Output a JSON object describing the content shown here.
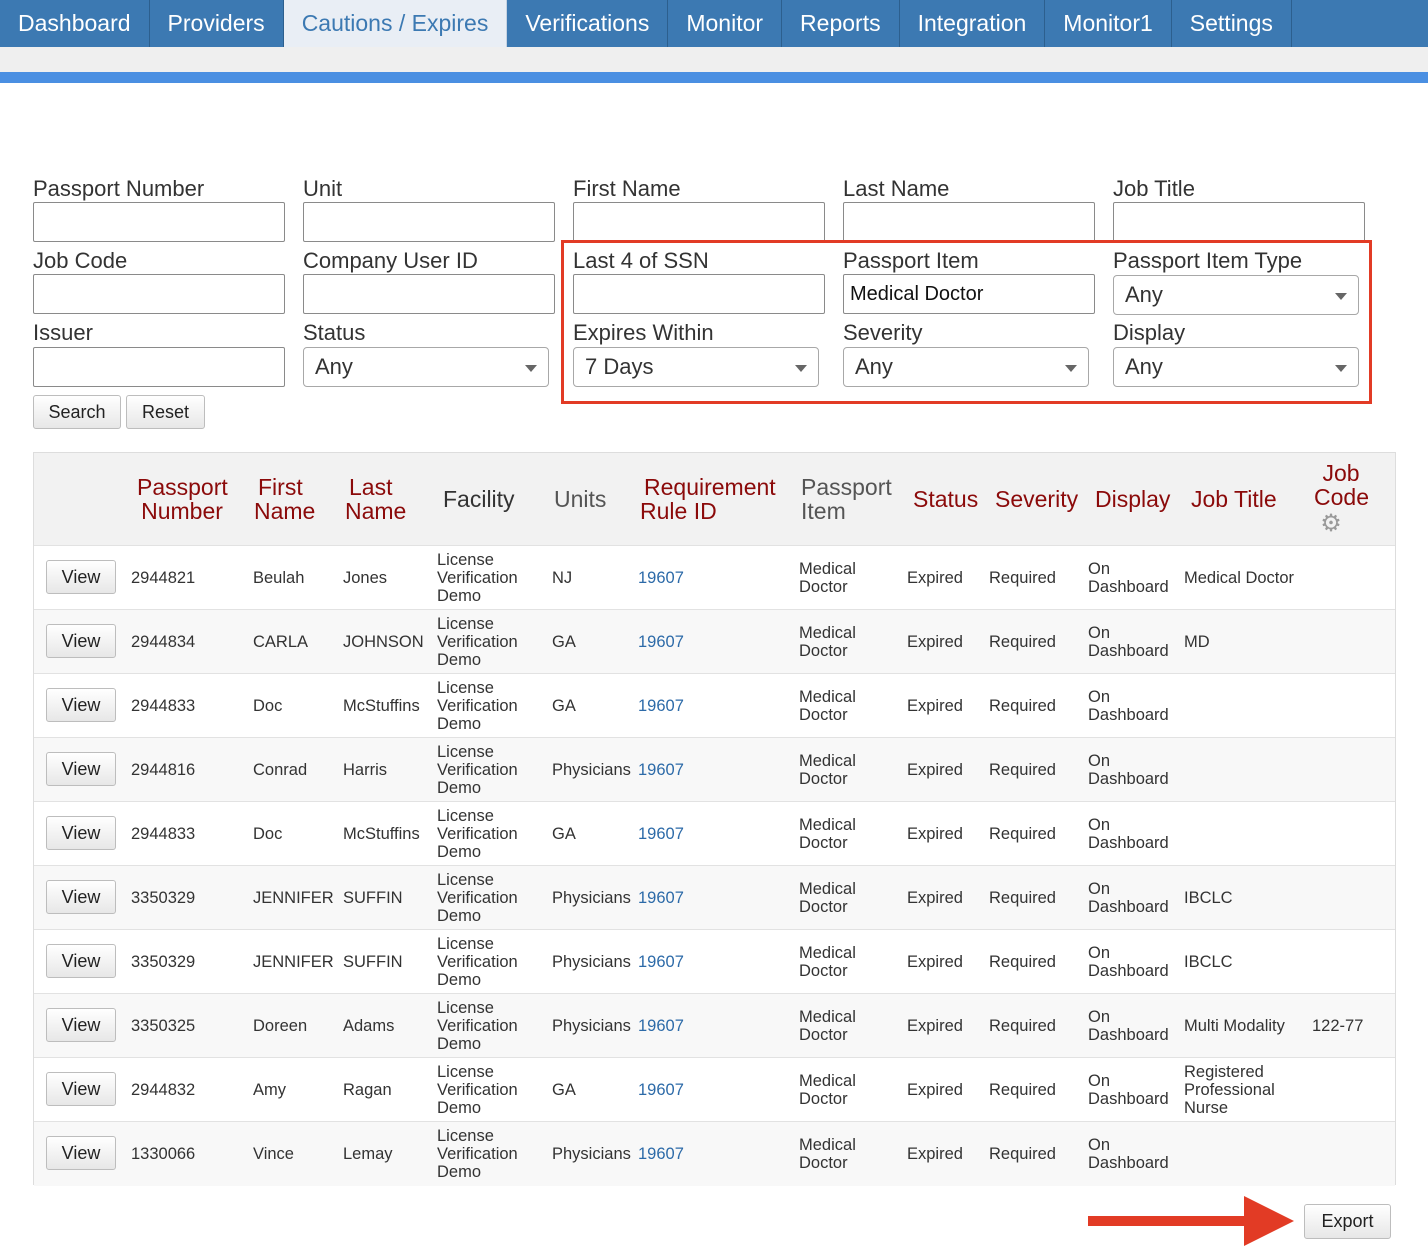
{
  "nav": {
    "tabs": [
      {
        "label": "Dashboard",
        "active": false
      },
      {
        "label": "Providers",
        "active": false
      },
      {
        "label": "Cautions / Expires",
        "active": true
      },
      {
        "label": "Verifications",
        "active": false
      },
      {
        "label": "Monitor",
        "active": false
      },
      {
        "label": "Reports",
        "active": false
      },
      {
        "label": "Integration",
        "active": false
      },
      {
        "label": "Monitor1",
        "active": false
      },
      {
        "label": "Settings",
        "active": false
      }
    ]
  },
  "filters": {
    "passport_number": {
      "label": "Passport Number",
      "value": ""
    },
    "unit": {
      "label": "Unit",
      "value": ""
    },
    "first_name": {
      "label": "First Name",
      "value": ""
    },
    "last_name": {
      "label": "Last Name",
      "value": ""
    },
    "job_title": {
      "label": "Job Title",
      "value": ""
    },
    "job_code": {
      "label": "Job Code",
      "value": ""
    },
    "company_user_id": {
      "label": "Company User ID",
      "value": ""
    },
    "last4_ssn": {
      "label": "Last 4 of SSN",
      "value": ""
    },
    "passport_item": {
      "label": "Passport Item",
      "value": "Medical Doctor"
    },
    "passport_item_type": {
      "label": "Passport Item Type",
      "value": "Any"
    },
    "issuer": {
      "label": "Issuer",
      "value": ""
    },
    "status": {
      "label": "Status",
      "value": "Any"
    },
    "expires_within": {
      "label": "Expires Within",
      "value": "7 Days"
    },
    "severity": {
      "label": "Severity",
      "value": "Any"
    },
    "display": {
      "label": "Display",
      "value": "Any"
    },
    "search_label": "Search",
    "reset_label": "Reset"
  },
  "table": {
    "headers": {
      "passport_number": [
        "Passport",
        "Number"
      ],
      "first_name": [
        "First",
        "Name"
      ],
      "last_name": [
        "Last",
        "Name"
      ],
      "facility": "Facility",
      "units": "Units",
      "requirement_rule_id": [
        "Requirement",
        "Rule ID"
      ],
      "passport_item": [
        "Passport",
        "Item"
      ],
      "status": "Status",
      "severity": "Severity",
      "display": "Display",
      "job_title": "Job Title",
      "job_code": [
        "Job",
        "Code"
      ]
    },
    "view_label": "View",
    "rows": [
      {
        "passport": "2944821",
        "first": "Beulah",
        "last": "Jones",
        "facility": [
          "License",
          "Verification",
          "Demo"
        ],
        "units": "NJ",
        "rule": "19607",
        "item": [
          "Medical",
          "Doctor"
        ],
        "status": "Expired",
        "severity": "Required",
        "display": [
          "On",
          "Dashboard"
        ],
        "job_title": [
          "Medical Doctor"
        ],
        "job_code": ""
      },
      {
        "passport": "2944834",
        "first": "CARLA",
        "last": "JOHNSON",
        "facility": [
          "License",
          "Verification",
          "Demo"
        ],
        "units": "GA",
        "rule": "19607",
        "item": [
          "Medical",
          "Doctor"
        ],
        "status": "Expired",
        "severity": "Required",
        "display": [
          "On",
          "Dashboard"
        ],
        "job_title": [
          "MD"
        ],
        "job_code": ""
      },
      {
        "passport": "2944833",
        "first": "Doc",
        "last": "McStuffins",
        "facility": [
          "License",
          "Verification",
          "Demo"
        ],
        "units": "GA",
        "rule": "19607",
        "item": [
          "Medical",
          "Doctor"
        ],
        "status": "Expired",
        "severity": "Required",
        "display": [
          "On",
          "Dashboard"
        ],
        "job_title": [],
        "job_code": ""
      },
      {
        "passport": "2944816",
        "first": "Conrad",
        "last": "Harris",
        "facility": [
          "License",
          "Verification",
          "Demo"
        ],
        "units": "Physicians",
        "rule": "19607",
        "item": [
          "Medical",
          "Doctor"
        ],
        "status": "Expired",
        "severity": "Required",
        "display": [
          "On",
          "Dashboard"
        ],
        "job_title": [],
        "job_code": ""
      },
      {
        "passport": "2944833",
        "first": "Doc",
        "last": "McStuffins",
        "facility": [
          "License",
          "Verification",
          "Demo"
        ],
        "units": "GA",
        "rule": "19607",
        "item": [
          "Medical",
          "Doctor"
        ],
        "status": "Expired",
        "severity": "Required",
        "display": [
          "On",
          "Dashboard"
        ],
        "job_title": [],
        "job_code": ""
      },
      {
        "passport": "3350329",
        "first": "JENNIFER",
        "last": "SUFFIN",
        "facility": [
          "License",
          "Verification",
          "Demo"
        ],
        "units": "Physicians",
        "rule": "19607",
        "item": [
          "Medical",
          "Doctor"
        ],
        "status": "Expired",
        "severity": "Required",
        "display": [
          "On",
          "Dashboard"
        ],
        "job_title": [
          "IBCLC"
        ],
        "job_code": ""
      },
      {
        "passport": "3350329",
        "first": "JENNIFER",
        "last": "SUFFIN",
        "facility": [
          "License",
          "Verification",
          "Demo"
        ],
        "units": "Physicians",
        "rule": "19607",
        "item": [
          "Medical",
          "Doctor"
        ],
        "status": "Expired",
        "severity": "Required",
        "display": [
          "On",
          "Dashboard"
        ],
        "job_title": [
          "IBCLC"
        ],
        "job_code": ""
      },
      {
        "passport": "3350325",
        "first": "Doreen",
        "last": "Adams",
        "facility": [
          "License",
          "Verification",
          "Demo"
        ],
        "units": "Physicians",
        "rule": "19607",
        "item": [
          "Medical",
          "Doctor"
        ],
        "status": "Expired",
        "severity": "Required",
        "display": [
          "On",
          "Dashboard"
        ],
        "job_title": [
          "Multi Modality"
        ],
        "job_code": "122-77"
      },
      {
        "passport": "2944832",
        "first": "Amy",
        "last": "Ragan",
        "facility": [
          "License",
          "Verification",
          "Demo"
        ],
        "units": "GA",
        "rule": "19607",
        "item": [
          "Medical",
          "Doctor"
        ],
        "status": "Expired",
        "severity": "Required",
        "display": [
          "On",
          "Dashboard"
        ],
        "job_title": [
          "Registered",
          "Professional",
          "Nurse"
        ],
        "job_code": ""
      },
      {
        "passport": "1330066",
        "first": "Vince",
        "last": "Lemay",
        "facility": [
          "License",
          "Verification",
          "Demo"
        ],
        "units": "Physicians",
        "rule": "19607",
        "item": [
          "Medical",
          "Doctor"
        ],
        "status": "Expired",
        "severity": "Required",
        "display": [
          "On",
          "Dashboard"
        ],
        "job_title": [],
        "job_code": ""
      }
    ]
  },
  "export_label": "Export",
  "colors": {
    "nav_bg": "#3c79b2",
    "accent_bar": "#4a8fe2",
    "highlight": "#e23b25",
    "header_text": "#8b0a0a",
    "link": "#2c6aa8"
  },
  "icons": {
    "settings": "gear-icon",
    "dropdown": "chevron-down-icon",
    "annotation": "arrow-right-icon"
  }
}
